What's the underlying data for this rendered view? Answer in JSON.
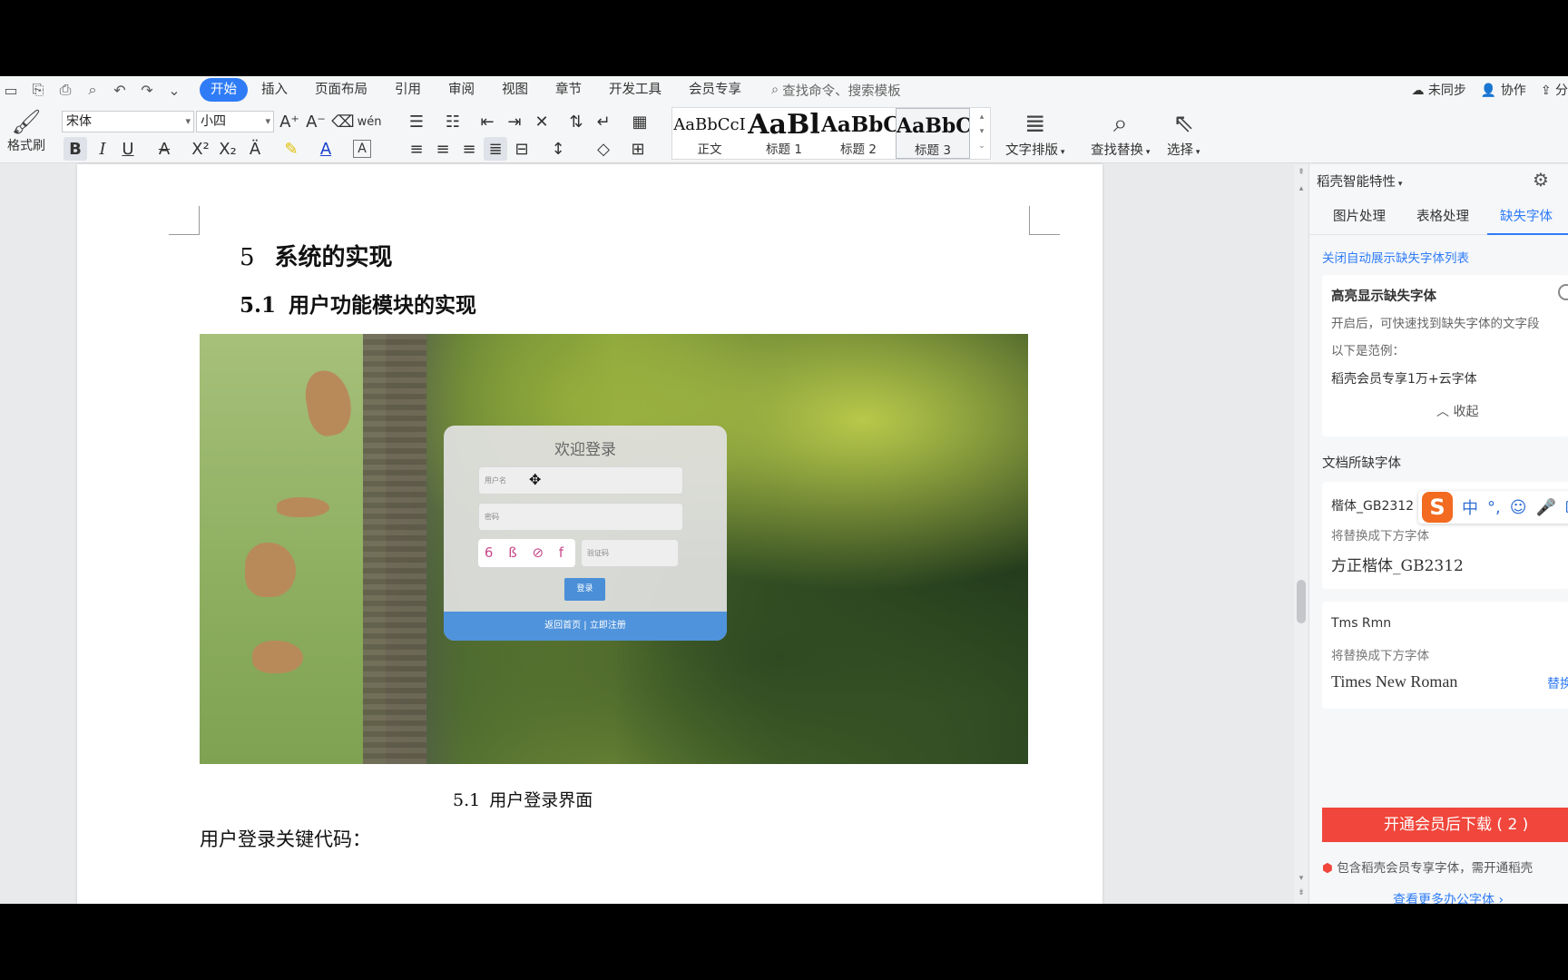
{
  "menubar": {
    "tabs": [
      "开始",
      "插入",
      "页面布局",
      "引用",
      "审阅",
      "视图",
      "章节",
      "开发工具",
      "会员专享"
    ],
    "active_tab": "开始",
    "search_placeholder": "查找命令、搜索模板",
    "right": {
      "sync": "未同步",
      "collab": "协作",
      "share": "分"
    }
  },
  "ribbon": {
    "format_painter": "格式刷",
    "font_name": "宋体",
    "font_size": "小四",
    "styles": [
      {
        "sample": "AaBbCcI",
        "label": "正文"
      },
      {
        "sample": "AaBl",
        "label": "标题 1"
      },
      {
        "sample": "AaBbC",
        "label": "标题 2"
      },
      {
        "sample": "AaBbC",
        "label": "标题 3"
      }
    ],
    "text_layout": "文字排版",
    "find_replace": "查找替换",
    "select": "选择"
  },
  "document": {
    "heading1": {
      "num": "5",
      "text": "系统的实现"
    },
    "heading2": {
      "num": "5.1",
      "text": "用户功能模块的实现"
    },
    "login": {
      "title": "欢迎登录",
      "username_placeholder": "用户名",
      "password_placeholder": "密码",
      "captcha": "6 ß ⊘ f",
      "captcha_placeholder": "验证码",
      "button": "登录",
      "footer": "返回首页 | 立即注册"
    },
    "caption": {
      "num": "5.1",
      "text": "用户登录界面"
    },
    "body": "用户登录关键代码："
  },
  "panel": {
    "title": "稻壳智能特性",
    "tabs": [
      "图片处理",
      "表格处理",
      "缺失字体"
    ],
    "active_tab": "缺失字体",
    "close_auto_link": "关闭自动展示缺失字体列表",
    "highlight_title": "高亮显示缺失字体",
    "highlight_desc": "开启后，可快速找到缺失字体的文字段",
    "example_label": "以下是范例：",
    "example_font": "稻壳会员专享1万+云字体",
    "collapse": "收起",
    "missing_title": "文档所缺字体",
    "missing_fonts": [
      {
        "name": "楷体_GB2312",
        "replace_label": "将替换成下方字体",
        "replacement": "方正楷体_GB2312",
        "action": ""
      },
      {
        "name": "Tms Rmn",
        "replace_label": "将替换成下方字体",
        "replacement": "Times New Roman",
        "action": "替换"
      }
    ],
    "vip_button": "开通会员后下载 ( 2 )",
    "vip_note": "包含稻壳会员专享字体，需开通稻壳",
    "more_link": "查看更多办公字体"
  },
  "ime": {
    "mode": "中"
  },
  "colors": {
    "accent": "#2f7cf6",
    "vip_red": "#f0463b",
    "login_blue": "#4f93dc"
  }
}
